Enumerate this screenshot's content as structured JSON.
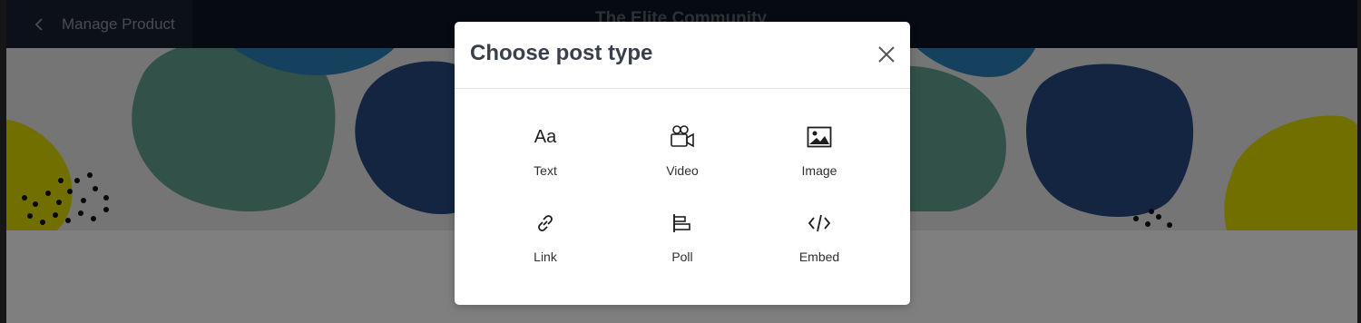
{
  "header": {
    "back_label": "Manage Product",
    "community_title": "The Elite Community"
  },
  "modal": {
    "title": "Choose post type",
    "options": [
      {
        "label": "Text",
        "icon": "text-aa-icon",
        "glyph": "Aa"
      },
      {
        "label": "Video",
        "icon": "video-camera-icon"
      },
      {
        "label": "Image",
        "icon": "image-icon"
      },
      {
        "label": "Link",
        "icon": "link-icon"
      },
      {
        "label": "Poll",
        "icon": "poll-icon"
      },
      {
        "label": "Embed",
        "icon": "code-icon"
      }
    ]
  },
  "colors": {
    "topbar": "#0c1626",
    "overlay": "rgba(0,0,0,0.48)",
    "modal_bg": "#ffffff",
    "title_text": "#3a3f4d"
  }
}
